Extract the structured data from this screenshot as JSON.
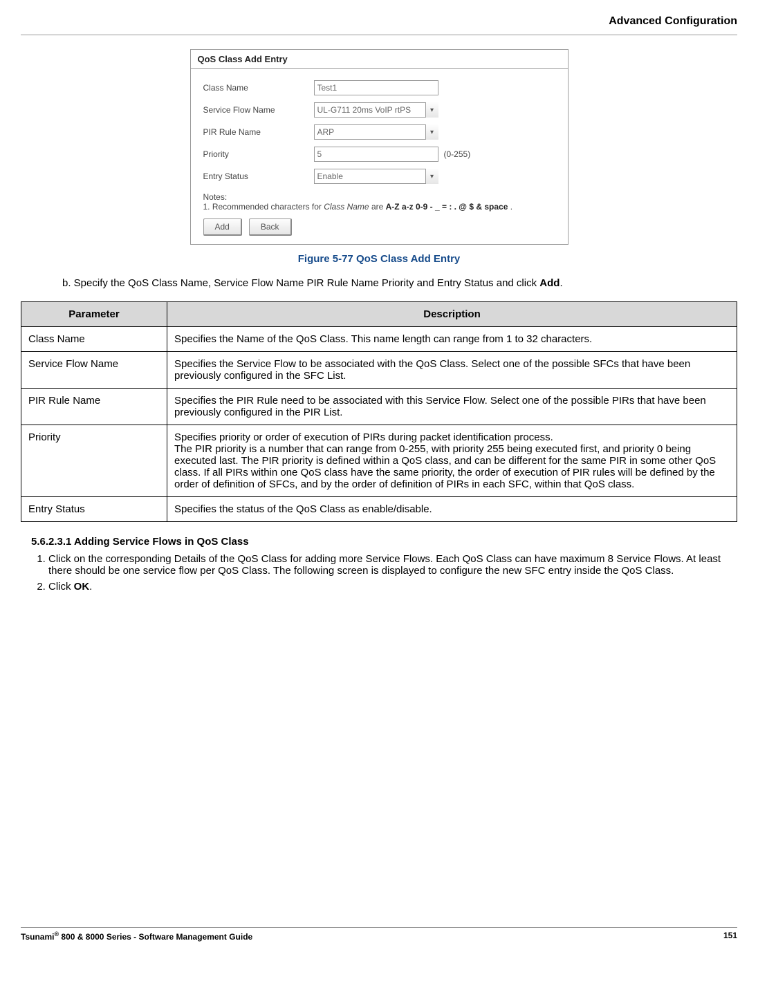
{
  "header": {
    "title": "Advanced Configuration"
  },
  "screenshot": {
    "panel_title": "QoS Class Add Entry",
    "fields": {
      "class_name_label": "Class Name",
      "class_name_value": "Test1",
      "sfn_label": "Service Flow Name",
      "sfn_value": "UL-G711 20ms VoIP rtPS",
      "pir_label": "PIR Rule Name",
      "pir_value": "ARP",
      "priority_label": "Priority",
      "priority_value": "5",
      "priority_hint": "(0-255)",
      "entry_status_label": "Entry Status",
      "entry_status_value": "Enable"
    },
    "notes_label": "Notes:",
    "notes_line1_prefix": "1. Recommended characters for ",
    "notes_line1_italic": "Class Name",
    "notes_line1_mid": " are ",
    "notes_line1_bold": "A-Z a-z 0-9 - _ = : . @ $ & space",
    "notes_line1_suffix": " .",
    "add_btn": "Add",
    "back_btn": "Back"
  },
  "figure_caption": "Figure 5-77 QoS Class Add Entry",
  "list_b_prefix": "b.   Specify the QoS Class Name, Service Flow Name PIR Rule Name Priority and Entry Status and click ",
  "list_b_bold": "Add",
  "list_b_suffix": ".",
  "table": {
    "head_param": "Parameter",
    "head_desc": "Description",
    "rows": [
      {
        "param": "Class Name",
        "desc": "Specifies the Name of the QoS Class. This name length can range from 1 to 32 characters."
      },
      {
        "param": "Service Flow Name",
        "desc": "Specifies the Service Flow to be associated with the QoS Class. Select one of the possible SFCs that have been previously configured in the SFC List."
      },
      {
        "param": "PIR Rule Name",
        "desc": "Specifies the PIR Rule need to be associated with this Service Flow. Select one of the possible PIRs that have been previously configured in the PIR List."
      },
      {
        "param": "Priority",
        "desc": "Specifies priority or order of execution of PIRs during packet identification process.\nThe PIR priority is a number that can range from 0-255, with priority 255 being executed first, and priority 0 being executed last. The PIR priority is defined within a QoS class, and can be different for the same PIR in some other QoS class. If all PIRs within one QoS class have the same priority, the order of execution of PIR rules will be defined by the order of definition of SFCs, and by the order of definition of PIRs in each SFC, within that QoS class."
      },
      {
        "param": "Entry Status",
        "desc": "Specifies the status of the QoS Class as enable/disable."
      }
    ]
  },
  "section_heading": "5.6.2.3.1 Adding Service Flows in QoS Class",
  "step1": "Click on the corresponding Details of the QoS Class for adding more Service Flows. Each QoS Class can have maximum 8 Service Flows. At least there should be one service flow per QoS Class. The following screen is displayed to configure the new SFC entry inside the QoS Class.",
  "step2_prefix": "Click ",
  "step2_bold": "OK",
  "step2_suffix": ".",
  "footer": {
    "left_prefix": "Tsunami",
    "left_sup": "®",
    "left_suffix": " 800 & 8000 Series - Software Management Guide",
    "page": "151"
  }
}
